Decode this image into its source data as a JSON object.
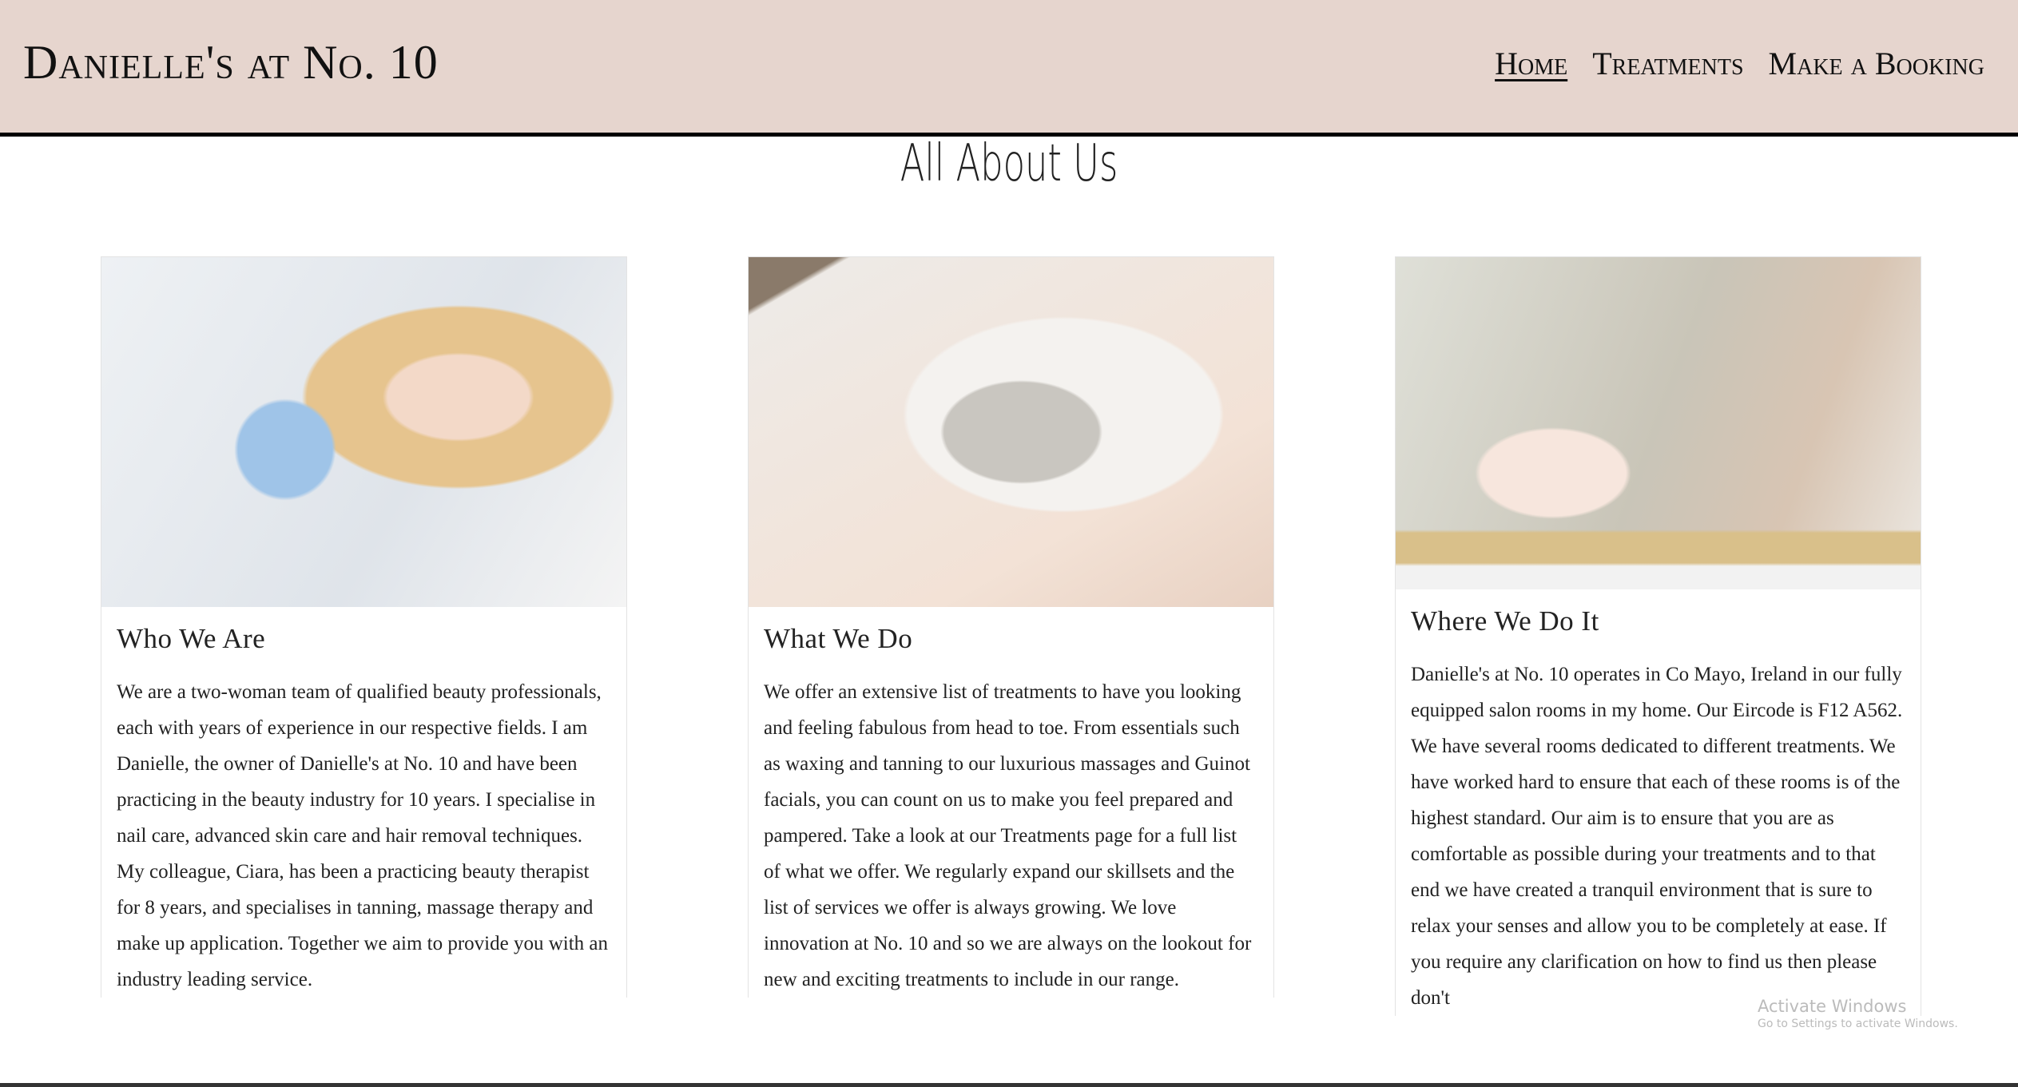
{
  "header": {
    "brand": "Danielle's at No. 10",
    "nav": [
      {
        "label": "Home",
        "active": true
      },
      {
        "label": "Treatments"
      },
      {
        "label": "Make a Booking"
      }
    ]
  },
  "page_title": "All About Us",
  "cards": [
    {
      "title": "Who We Are",
      "image": "beautician-with-client-photo",
      "body": "We are a two-woman team of qualified beauty professionals, each with years of experience in our respective fields. I am Danielle, the owner of Danielle's at No. 10 and have been practicing in the beauty industry for 10 years. I specialise in nail care, advanced skin care and hair removal techniques. My colleague, Ciara, has been a practicing beauty therapist for 8 years, and specialises in tanning, massage therapy and make up application. Together we aim to provide you with an industry leading service."
    },
    {
      "title": "What We Do",
      "image": "facial-mask-photo",
      "body": "We offer an extensive list of treatments to have you looking and feeling fabulous from head to toe. From essentials such as waxing and tanning to our luxurious massages and Guinot facials, you can count on us to make you feel prepared and pampered. Take a look at our Treatments page for a full list of what we offer. We regularly expand our skillsets and the list of services we offer is always growing. We love innovation at No. 10 and so we are always on the lookout for new and exciting treatments to include in our range."
    },
    {
      "title": "Where We Do It",
      "image": "candles-spa-photo",
      "body": "Danielle's at No. 10 operates in Co Mayo, Ireland in our fully equipped salon rooms in my home. Our Eircode is F12 A562. We have several rooms dedicated to different treatments. We have worked hard to ensure that each of these rooms is of the highest standard. Our aim is to ensure that you are as comfortable as possible during your treatments and to that end we have created a tranquil environment that is sure to relax your senses and allow you to be completely at ease. If you require any clarification on how to find us then please don't"
    }
  ],
  "watermark": {
    "line1": "Activate Windows",
    "line2": "Go to Settings to activate Windows."
  },
  "colors": {
    "header_bg": "#e6d5ce"
  }
}
